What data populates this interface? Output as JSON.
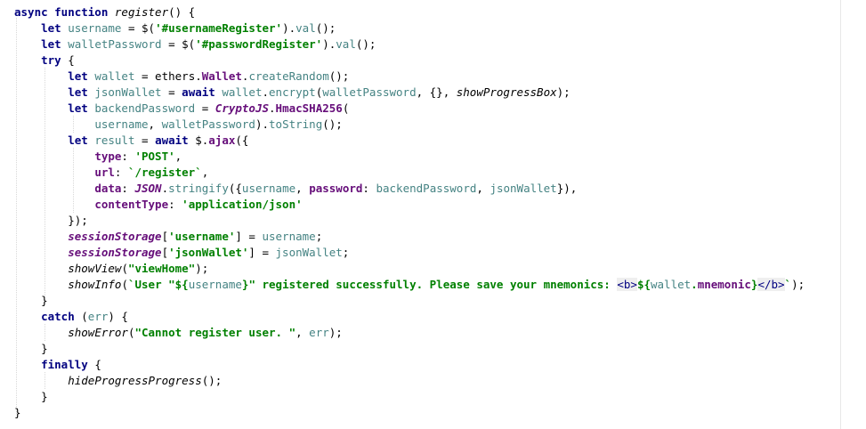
{
  "code_lines": [
    [
      {
        "t": "async function ",
        "c": "kw"
      },
      {
        "t": "register",
        "c": "ital"
      },
      {
        "t": "() {",
        "c": ""
      }
    ],
    [
      {
        "t": "    ",
        "c": ""
      },
      {
        "t": "let ",
        "c": "kw"
      },
      {
        "t": "username",
        "c": "var"
      },
      {
        "t": " = $(",
        "c": ""
      },
      {
        "t": "'#usernameRegister'",
        "c": "str"
      },
      {
        "t": ").",
        "c": ""
      },
      {
        "t": "val",
        "c": "fn"
      },
      {
        "t": "();",
        "c": ""
      }
    ],
    [
      {
        "t": "    ",
        "c": ""
      },
      {
        "t": "let ",
        "c": "kw"
      },
      {
        "t": "walletPassword",
        "c": "var"
      },
      {
        "t": " = $(",
        "c": ""
      },
      {
        "t": "'#passwordRegister'",
        "c": "str"
      },
      {
        "t": ").",
        "c": ""
      },
      {
        "t": "val",
        "c": "fn"
      },
      {
        "t": "();",
        "c": ""
      }
    ],
    [
      {
        "t": "    ",
        "c": ""
      },
      {
        "t": "try ",
        "c": "kw"
      },
      {
        "t": "{",
        "c": ""
      }
    ],
    [
      {
        "t": "        ",
        "c": ""
      },
      {
        "t": "let ",
        "c": "kw"
      },
      {
        "t": "wallet",
        "c": "var"
      },
      {
        "t": " = ethers.",
        "c": ""
      },
      {
        "t": "Wallet",
        "c": "prop"
      },
      {
        "t": ".",
        "c": ""
      },
      {
        "t": "createRandom",
        "c": "fn"
      },
      {
        "t": "();",
        "c": ""
      }
    ],
    [
      {
        "t": "        ",
        "c": ""
      },
      {
        "t": "let ",
        "c": "kw"
      },
      {
        "t": "jsonWallet",
        "c": "var"
      },
      {
        "t": " = ",
        "c": ""
      },
      {
        "t": "await ",
        "c": "kw"
      },
      {
        "t": "wallet",
        "c": "var"
      },
      {
        "t": ".",
        "c": ""
      },
      {
        "t": "encrypt",
        "c": "fn"
      },
      {
        "t": "(",
        "c": ""
      },
      {
        "t": "walletPassword",
        "c": "var"
      },
      {
        "t": ", {}, ",
        "c": ""
      },
      {
        "t": "showProgressBox",
        "c": "ital"
      },
      {
        "t": ");",
        "c": ""
      }
    ],
    [
      {
        "t": "        ",
        "c": ""
      },
      {
        "t": "let ",
        "c": "kw"
      },
      {
        "t": "backendPassword",
        "c": "var"
      },
      {
        "t": " = ",
        "c": ""
      },
      {
        "t": "CryptoJS",
        "c": "prop ital"
      },
      {
        "t": ".",
        "c": ""
      },
      {
        "t": "HmacSHA256",
        "c": "prop"
      },
      {
        "t": "(",
        "c": ""
      }
    ],
    [
      {
        "t": "            ",
        "c": ""
      },
      {
        "t": "username",
        "c": "var"
      },
      {
        "t": ", ",
        "c": ""
      },
      {
        "t": "walletPassword",
        "c": "var"
      },
      {
        "t": ").",
        "c": ""
      },
      {
        "t": "toString",
        "c": "fn"
      },
      {
        "t": "();",
        "c": ""
      }
    ],
    [
      {
        "t": "        ",
        "c": ""
      },
      {
        "t": "let ",
        "c": "kw"
      },
      {
        "t": "result",
        "c": "var"
      },
      {
        "t": " = ",
        "c": ""
      },
      {
        "t": "await ",
        "c": "kw"
      },
      {
        "t": "$.",
        "c": ""
      },
      {
        "t": "ajax",
        "c": "prop"
      },
      {
        "t": "({",
        "c": ""
      }
    ],
    [
      {
        "t": "            ",
        "c": ""
      },
      {
        "t": "type",
        "c": "prop"
      },
      {
        "t": ": ",
        "c": ""
      },
      {
        "t": "'POST'",
        "c": "str"
      },
      {
        "t": ",",
        "c": ""
      }
    ],
    [
      {
        "t": "            ",
        "c": ""
      },
      {
        "t": "url",
        "c": "prop"
      },
      {
        "t": ": ",
        "c": ""
      },
      {
        "t": "`/register`",
        "c": "str"
      },
      {
        "t": ",",
        "c": ""
      }
    ],
    [
      {
        "t": "            ",
        "c": ""
      },
      {
        "t": "data",
        "c": "prop"
      },
      {
        "t": ": ",
        "c": ""
      },
      {
        "t": "JSON",
        "c": "prop ital"
      },
      {
        "t": ".",
        "c": ""
      },
      {
        "t": "stringify",
        "c": "fn"
      },
      {
        "t": "({",
        "c": ""
      },
      {
        "t": "username",
        "c": "var"
      },
      {
        "t": ", ",
        "c": ""
      },
      {
        "t": "password",
        "c": "prop"
      },
      {
        "t": ": ",
        "c": ""
      },
      {
        "t": "backendPassword",
        "c": "var"
      },
      {
        "t": ", ",
        "c": ""
      },
      {
        "t": "jsonWallet",
        "c": "var"
      },
      {
        "t": "}),",
        "c": ""
      }
    ],
    [
      {
        "t": "            ",
        "c": ""
      },
      {
        "t": "contentType",
        "c": "prop"
      },
      {
        "t": ": ",
        "c": ""
      },
      {
        "t": "'application/json'",
        "c": "str"
      }
    ],
    [
      {
        "t": "        ",
        "c": ""
      },
      {
        "t": "});",
        "c": ""
      }
    ],
    [
      {
        "t": "        ",
        "c": ""
      },
      {
        "t": "sessionStorage",
        "c": "prop ital"
      },
      {
        "t": "[",
        "c": ""
      },
      {
        "t": "'username'",
        "c": "str"
      },
      {
        "t": "] = ",
        "c": ""
      },
      {
        "t": "username",
        "c": "var"
      },
      {
        "t": ";",
        "c": ""
      }
    ],
    [
      {
        "t": "        ",
        "c": ""
      },
      {
        "t": "sessionStorage",
        "c": "prop ital"
      },
      {
        "t": "[",
        "c": ""
      },
      {
        "t": "'jsonWallet'",
        "c": "str"
      },
      {
        "t": "] = ",
        "c": ""
      },
      {
        "t": "jsonWallet",
        "c": "var"
      },
      {
        "t": ";",
        "c": ""
      }
    ],
    [
      {
        "t": "        ",
        "c": ""
      },
      {
        "t": "showView",
        "c": "ital"
      },
      {
        "t": "(",
        "c": ""
      },
      {
        "t": "\"viewHome\"",
        "c": "str"
      },
      {
        "t": ");",
        "c": ""
      }
    ],
    [
      {
        "t": "        ",
        "c": ""
      },
      {
        "t": "showInfo",
        "c": "ital"
      },
      {
        "t": "(",
        "c": ""
      },
      {
        "t": "`User \"${",
        "c": "str"
      },
      {
        "t": "username",
        "c": "var"
      },
      {
        "t": "}\" registered successfully. Please save your mnemonics: ",
        "c": "str"
      },
      {
        "t": "<b>",
        "c": "tag"
      },
      {
        "t": "${",
        "c": "str"
      },
      {
        "t": "wallet",
        "c": "var"
      },
      {
        "t": ".",
        "c": "str"
      },
      {
        "t": "mnemonic",
        "c": "prop"
      },
      {
        "t": "}",
        "c": "str"
      },
      {
        "t": "</b>",
        "c": "tag"
      },
      {
        "t": "`",
        "c": "str"
      },
      {
        "t": ");",
        "c": ""
      }
    ],
    [
      {
        "t": "    ",
        "c": ""
      },
      {
        "t": "}",
        "c": ""
      }
    ],
    [
      {
        "t": "    ",
        "c": ""
      },
      {
        "t": "catch ",
        "c": "kw"
      },
      {
        "t": "(",
        "c": ""
      },
      {
        "t": "err",
        "c": "var"
      },
      {
        "t": ") {",
        "c": ""
      }
    ],
    [
      {
        "t": "        ",
        "c": ""
      },
      {
        "t": "showError",
        "c": "ital"
      },
      {
        "t": "(",
        "c": ""
      },
      {
        "t": "\"Cannot register user. \"",
        "c": "str"
      },
      {
        "t": ", ",
        "c": ""
      },
      {
        "t": "err",
        "c": "var"
      },
      {
        "t": ");",
        "c": ""
      }
    ],
    [
      {
        "t": "    ",
        "c": ""
      },
      {
        "t": "}",
        "c": ""
      }
    ],
    [
      {
        "t": "    ",
        "c": ""
      },
      {
        "t": "finally ",
        "c": "kw"
      },
      {
        "t": "{",
        "c": ""
      }
    ],
    [
      {
        "t": "        ",
        "c": ""
      },
      {
        "t": "hideProgressProgress",
        "c": "ital"
      },
      {
        "t": "();",
        "c": ""
      }
    ],
    [
      {
        "t": "    ",
        "c": ""
      },
      {
        "t": "}",
        "c": ""
      }
    ],
    [
      {
        "t": "}",
        "c": ""
      }
    ]
  ]
}
